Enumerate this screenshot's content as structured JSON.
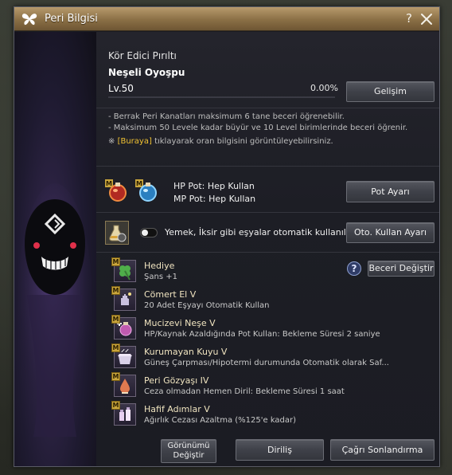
{
  "window": {
    "title": "Peri Bilgisi",
    "help": "?",
    "icons": {
      "title": "butterfly-icon",
      "close": "close-icon"
    }
  },
  "fairy": {
    "type_name": "Kör Edici Pırıltı",
    "name": "Neşeli Oyoşpu",
    "level": "Lv.50",
    "progress_text": "0.00%",
    "progress_fraction": 0.0,
    "growth_button": "Gelişim"
  },
  "info": {
    "line1": "- Berrak Peri Kanatları maksimum 6 tane beceri öğrenebilir.",
    "line2": "- Maksimum 50 Levele kadar büyür ve 10 Level birimlerinde beceri öğrenir.",
    "note_mark": "※",
    "note_link": "[Buraya]",
    "note_rest": "tıklayarak oran bilgisini görüntüleyebilirsiniz."
  },
  "potions": {
    "hp": "HP Pot: Hep Kullan",
    "mp": "MP Pot: Hep Kullan",
    "button": "Pot Ayarı",
    "icons": [
      "hp-potion-icon",
      "mp-potion-icon"
    ]
  },
  "auto_use": {
    "text": "Yemek, İksir gibi eşyalar otomatik kullanılır.",
    "button": "Oto. Kullan Ayarı",
    "toggle_on": false
  },
  "skills": {
    "help": "?",
    "change_button": "Beceri Değiştir",
    "badge": "M",
    "gift": {
      "title": "Hediye",
      "desc": "Şans +1",
      "icon": "clover-icon"
    },
    "list": [
      {
        "title": "Cömert El V",
        "desc": "20 Adet Eşyayı Otomatik Kullan",
        "icon": "hand-icon"
      },
      {
        "title": "Mucizevi Neşe V",
        "desc": "HP/Kaynak Azaldığında Pot Kullan: Bekleme Süresi 2 saniye",
        "icon": "potion-plus-icon"
      },
      {
        "title": "Kurumayan Kuyu V",
        "desc": "Güneş Çarpması/Hipotermi durumunda Otomatik olarak Saf...",
        "icon": "well-icon"
      },
      {
        "title": "Peri Gözyaşı IV",
        "desc": "Ceza olmadan Hemen Diril: Bekleme Süresi 1 saat",
        "icon": "tear-icon"
      },
      {
        "title": "Hafif Adımlar V",
        "desc": "Ağırlık Cezası Azaltma (%125'e kadar)",
        "icon": "bottles-icon"
      }
    ]
  },
  "footer": {
    "appearance_line1": "Görünümü",
    "appearance_line2": "Değiştir",
    "revive": "Diriliş",
    "end_summon": "Çağrı Sonlandırma"
  },
  "colors": {
    "title_bar": "#9a7e52",
    "link": "#f1c232",
    "panel_bg": "#1d1e25"
  }
}
